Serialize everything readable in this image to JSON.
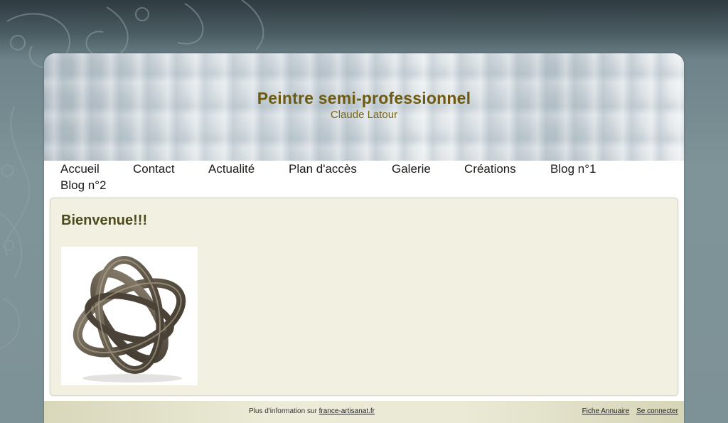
{
  "header": {
    "title": "Peintre semi-professionnel",
    "subtitle": "Claude Latour"
  },
  "nav": {
    "items": [
      {
        "label": "Accueil"
      },
      {
        "label": "Contact"
      },
      {
        "label": "Actualité"
      },
      {
        "label": "Plan d'accès"
      },
      {
        "label": "Galerie"
      },
      {
        "label": "Créations"
      },
      {
        "label": "Blog n°1"
      },
      {
        "label": "Blog n°2"
      }
    ]
  },
  "main": {
    "heading": "Bienvenue!!!",
    "image_icon": "metal-ring-sculpture"
  },
  "footer": {
    "info_prefix": "Plus d'information sur",
    "info_link": "france-artisanat.fr",
    "link_fiche": "Fiche Annuaire",
    "link_login": "Se connecter"
  },
  "colors": {
    "title": "#6e5a0f",
    "content_bg": "#f2f0e1",
    "footer_bg": "#ecebd7"
  }
}
